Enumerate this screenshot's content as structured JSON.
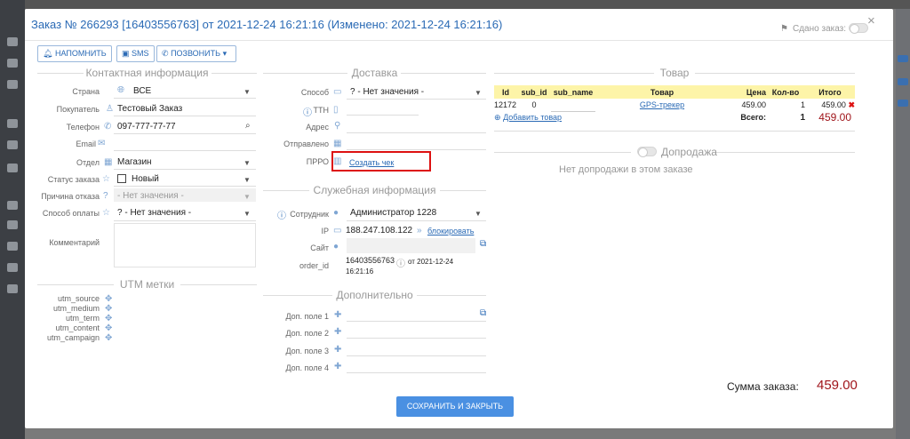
{
  "header": {
    "title": "Заказ № 266293 [16403556763] от 2021-12-24 16:21:16 (Изменено: 2021-12-24 16:21:16)",
    "handed_label": "Сдано заказ:",
    "close": "×"
  },
  "toolbar": {
    "remind": "НАПОМНИТЬ",
    "sms": "SMS",
    "call": "ПОЗВОНИТЬ"
  },
  "contact": {
    "section": "Контактная информация",
    "country_label": "Страна",
    "country": "ВСЕ",
    "buyer_label": "Покупатель",
    "buyer": "Тестовый Заказ",
    "phone_label": "Телефон",
    "phone": "097-777-77-77",
    "email_label": "Email",
    "dept_label": "Отдел",
    "dept": "Магазин",
    "status_label": "Статус заказа",
    "status": "Новый",
    "reject_label": "Причина отказа",
    "reject": "- Нет значения -",
    "payment_label": "Способ оплаты",
    "payment": "? - Нет значения -",
    "comment_label": "Комментарий"
  },
  "utm": {
    "section": "UTM метки",
    "source": "utm_source",
    "medium": "utm_medium",
    "term": "utm_term",
    "content": "utm_content",
    "campaign": "utm_campaign"
  },
  "delivery": {
    "section": "Доставка",
    "method_label": "Способ",
    "method": "? - Нет значения -",
    "ttn_label": "ТТН",
    "address_label": "Адрес",
    "sent_label": "Отправлено",
    "prro_label": "ПРРО",
    "create_receipt": "Создать чек"
  },
  "service": {
    "section": "Служебная информация",
    "employee_label": "Сотрудник",
    "employee": "Администратор 1228",
    "ip_label": "IP",
    "ip": "188.247.108.122",
    "block": "блокировать",
    "site_label": "Сайт",
    "orderid_label": "order_id",
    "orderid": "16403556763",
    "orderid_date": "от 2021-12-24",
    "orderid_time": "16:21:16"
  },
  "extra": {
    "section": "Дополнительно",
    "f1": "Доп. поле 1",
    "f2": "Доп. поле 2",
    "f3": "Доп. поле 3",
    "f4": "Доп. поле 4"
  },
  "goods": {
    "section": "Товар",
    "cols": [
      "Id",
      "sub_id",
      "sub_name",
      "Товар",
      "Цена",
      "Кол-во",
      "Итого"
    ],
    "row": {
      "id": "12172",
      "sub_id": "0",
      "sub_name": "",
      "product": "GPS-трекер",
      "price": "459.00",
      "qty": "1",
      "total": "459.00"
    },
    "add": "Добавить товар",
    "total_label": "Всего:",
    "total_qty": "1",
    "total_sum": "459.00"
  },
  "upsell": {
    "section": "Допродажа",
    "empty": "Нет допродажи в этом заказе"
  },
  "summary": {
    "label": "Сумма заказа:",
    "value": "459.00"
  },
  "footer": {
    "save": "СОХРАНИТЬ И ЗАКРЫТЬ"
  },
  "colors": {
    "accent": "#2a6ab5",
    "price": "#a0151b",
    "highlight": "#fdf4a8",
    "marker": "#dd1111"
  }
}
